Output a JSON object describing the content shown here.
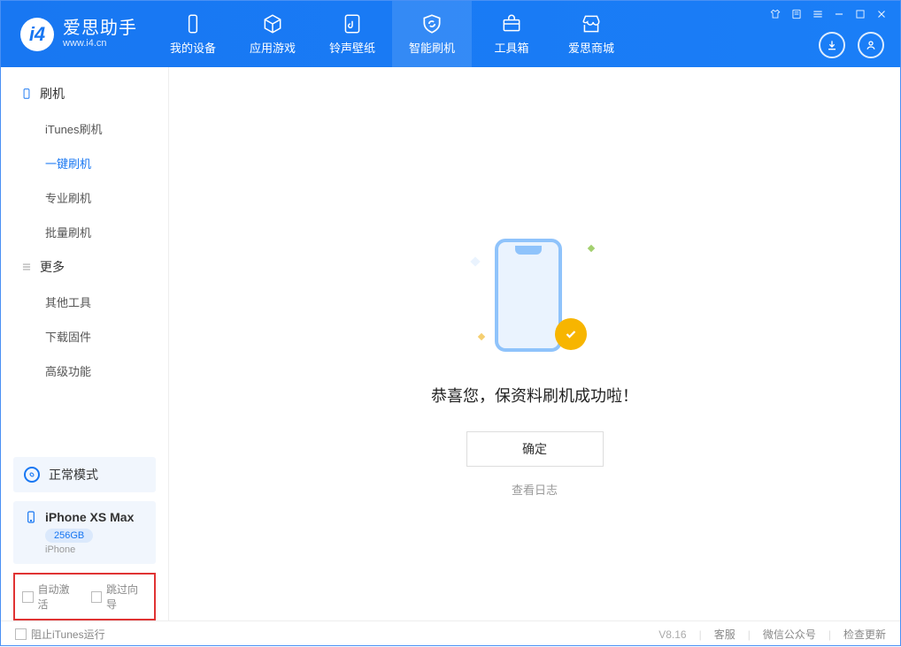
{
  "app": {
    "title": "爱思助手",
    "subtitle": "www.i4.cn"
  },
  "nav": [
    {
      "label": "我的设备"
    },
    {
      "label": "应用游戏"
    },
    {
      "label": "铃声壁纸"
    },
    {
      "label": "智能刷机"
    },
    {
      "label": "工具箱"
    },
    {
      "label": "爱思商城"
    }
  ],
  "sidebar": {
    "flash": {
      "header": "刷机",
      "items": [
        "iTunes刷机",
        "一键刷机",
        "专业刷机",
        "批量刷机"
      ]
    },
    "more": {
      "header": "更多",
      "items": [
        "其他工具",
        "下载固件",
        "高级功能"
      ]
    }
  },
  "mode": {
    "label": "正常模式"
  },
  "device": {
    "name": "iPhone XS Max",
    "storage": "256GB",
    "type": "iPhone"
  },
  "options": {
    "autoActivate": "自动激活",
    "skipGuide": "跳过向导"
  },
  "main": {
    "successTitle": "恭喜您，保资料刷机成功啦！",
    "okButton": "确定",
    "viewLog": "查看日志"
  },
  "footer": {
    "blockItunes": "阻止iTunes运行",
    "version": "V8.16",
    "links": [
      "客服",
      "微信公众号",
      "检查更新"
    ]
  }
}
